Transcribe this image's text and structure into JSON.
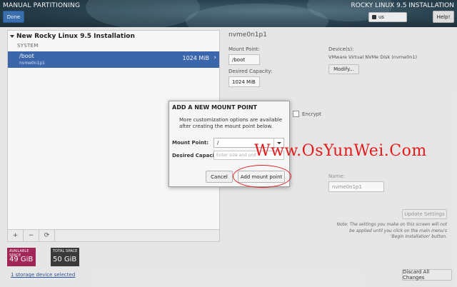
{
  "header": {
    "title": "MANUAL PARTITIONING",
    "done_label": "Done",
    "product_title": "ROCKY LINUX 9.5 INSTALLATION",
    "keyboard_layout": "us",
    "help_label": "Help!"
  },
  "left": {
    "install_name": "New Rocky Linux 9.5 Installation",
    "system_label": "SYSTEM",
    "partitions": [
      {
        "mount_point": "/boot",
        "device": "nvme0n1p1",
        "size": "1024 MiB",
        "selected": true
      }
    ],
    "tools": {
      "add": "+",
      "remove": "−",
      "refresh": "⟳"
    },
    "available_space": {
      "label": "AVAILABLE SPACE",
      "value": "49 GiB",
      "color": "#a8275a"
    },
    "total_space": {
      "label": "TOTAL SPACE",
      "value": "50 GiB",
      "color": "#3c3c3c"
    },
    "storage_link": "1 storage device selected"
  },
  "right": {
    "title": "nvme0n1p1",
    "mount_point_label": "Mount Point:",
    "mount_point_value": "/boot",
    "desired_capacity_label": "Desired Capacity:",
    "desired_capacity_value": "1024 MiB",
    "devices_label": "Device(s):",
    "device_desc": "VMware Virtual NVMe Disk (nvme0n1)",
    "modify_label": "Modify...",
    "encrypt_label": "Encrypt",
    "name_label": "Name:",
    "name_value": "nvme0n1p1",
    "update_settings_label": "Update Settings",
    "note": "Note:  The settings you make on this screen will not be applied until you click on the main menu's 'Begin Installation' button.",
    "discard_label": "Discard All Changes"
  },
  "dialog": {
    "title": "ADD A NEW MOUNT POINT",
    "description": "More customization options are available after creating the mount point below.",
    "mount_point_label": "Mount Point:",
    "mount_point_value": "/",
    "capacity_label": "Desired Capacity:",
    "capacity_placeholder": "Enter size and unit",
    "cancel_label": "Cancel",
    "add_label": "Add mount point"
  },
  "watermark": "Www.OsYunWei.Com"
}
